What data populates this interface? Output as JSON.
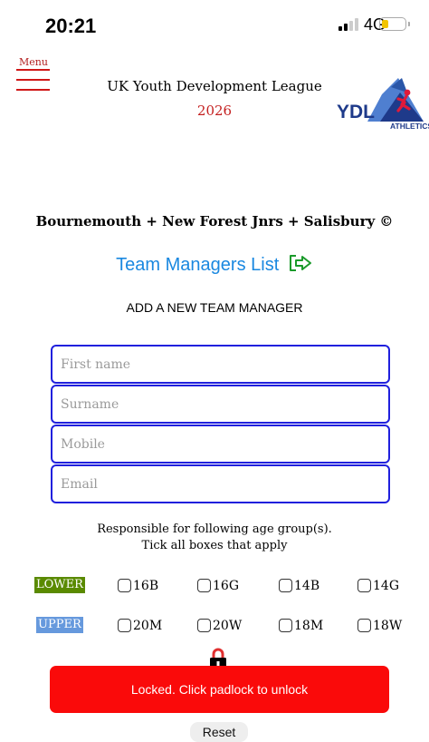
{
  "status_bar": {
    "time": "20:21",
    "network": "4G",
    "battery_level": 0.3
  },
  "header": {
    "menu_label": "Menu",
    "league_title": "UK Youth Development League",
    "year": "2026",
    "logo": {
      "primary": "YDL",
      "secondary": "ATHLETICS"
    }
  },
  "club_title": "Bournemouth + New Forest Jnrs + Salisbury ©",
  "team_managers_link": "Team Managers List",
  "form": {
    "heading": "ADD A NEW TEAM MANAGER",
    "fields": [
      {
        "placeholder": "First name",
        "value": ""
      },
      {
        "placeholder": "Surname",
        "value": ""
      },
      {
        "placeholder": "Mobile",
        "value": ""
      },
      {
        "placeholder": "Email",
        "value": ""
      }
    ],
    "age_group_hint_line1": "Responsible for following age group(s).",
    "age_group_hint_line2": "Tick all boxes that apply",
    "groups": [
      {
        "label": "LOWER",
        "color": "#5a8a00",
        "options": [
          "16B",
          "16G",
          "14B",
          "14G"
        ]
      },
      {
        "label": "UPPER",
        "color": "#6699dd",
        "options": [
          "20M",
          "20W",
          "18M",
          "18W"
        ]
      }
    ]
  },
  "lock_message": "Locked. Click padlock to unlock",
  "reset_label": "Reset",
  "colors": {
    "link": "#1a88e0",
    "menu": "#d01818",
    "field_border": "#2020dd",
    "lock_bar": "#fa0a0a",
    "year": "#c42020"
  }
}
